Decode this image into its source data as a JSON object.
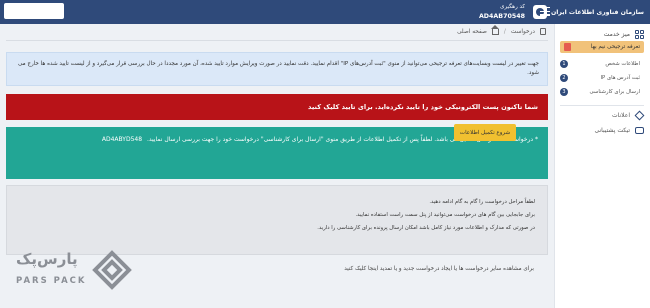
{
  "header": {
    "brand_name": "سازمان فناوری اطلاعات ایران",
    "tracking_label": "کد رهگیری",
    "tracking_code": "AD4AB70548"
  },
  "sidebar": {
    "title": "میز خدمت",
    "sub_item": "تعرفه ترجیحی نیم بها",
    "steps": [
      {
        "num": "1",
        "label": "اطلاعات شخص"
      },
      {
        "num": "2",
        "label": "ثبت آدرس های IP"
      },
      {
        "num": "3",
        "label": "ارسال برای کارشناسی"
      }
    ],
    "notifications_label": "اعلانات",
    "support_label": "تیکت پشتیبانی"
  },
  "breadcrumb": {
    "home": "صفحه اصلی",
    "current": "درخواست"
  },
  "alerts": {
    "blue": "جهت تغییر در لیست وبسایت‌های تعرفه ترجیحی می‌توانید از منوی \"ثبت آدرس‌های IP\" اقدام نمایید. دقت نمایید در صورت ویرایش موارد تایید شده، آن مورد مجددا در حال بررسی قرار می‌گیرد و از لیست تایید شده ها خارج می شود.",
    "red": "شما تاکنون پست الکترونیکی خود را تایید نکرده‌اید. برای تایید کلیک کنید",
    "green": "* درخواست شما در حال تکمیل می باشد. لطفاً پس از تکمیل اطلاعات از طریق منوی \"ارسال برای کارشناسی\" درخواست خود را جهت بررسی ارسال نمایید.",
    "green_code": "AD4ABYD548"
  },
  "start_button": "شروع تکمیل اطلاعات",
  "info_lines": [
    "لطفاً مراحل درخواست را گام به گام ادامه دهید.",
    "برای جابجایی بین گام های درخواست می‌توانید از پنل سمت راست استفاده نمایید.",
    "در صورتی که مدارک و اطلاعات مورد نیاز کامل باشد امکان ارسال پرونده برای کارشناسی را دارید."
  ],
  "footer_text": "برای مشاهده سایر درخواست ها یا ایجاد درخواست جدید و یا تمدید اینجا کلیک کنید",
  "watermark": {
    "fa": "پارس‌پک",
    "en": "PARS PACK"
  },
  "colors": {
    "header": "#2f4a7a",
    "alert_red": "#b81318",
    "alert_green": "#22a695",
    "button_yellow": "#f1c030",
    "sidebar_active": "#f1c27a"
  }
}
